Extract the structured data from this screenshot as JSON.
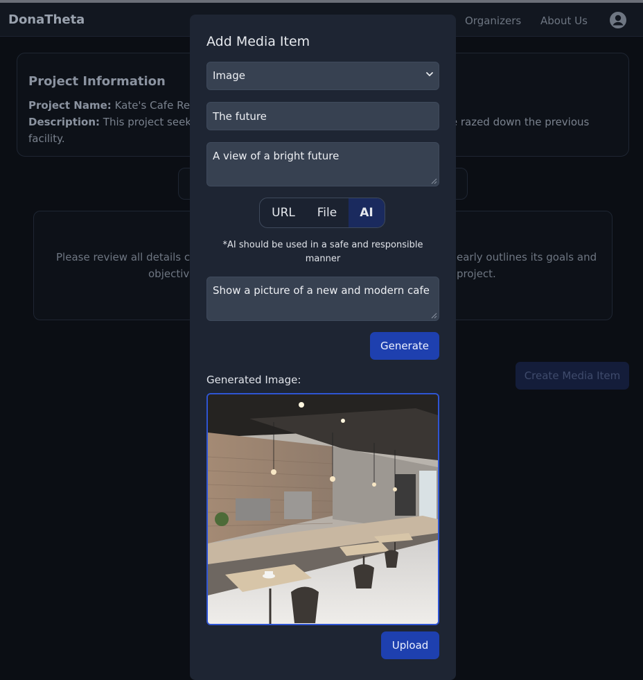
{
  "navbar": {
    "brand": "DonaTheta",
    "links": [
      "Organizers",
      "About Us"
    ],
    "account_icon": "account-circle-icon"
  },
  "project_info": {
    "title": "Project Information",
    "name_label": "Project Name:",
    "name_value": "Kate's Cafe Rebu",
    "description_label": "Description:",
    "description_value": "This project seeks",
    "description_right": "re razed down the previous",
    "description_cont": "facility."
  },
  "review_notice": {
    "left_line1": "Please review all details co",
    "left_line2": "objectiv",
    "right_line1": "early outlines its goals and",
    "right_line2": "project."
  },
  "create_button_label": "Create Media Item",
  "modal": {
    "title": "Add Media Item",
    "type_select": {
      "value": "Image",
      "options": [
        "Image"
      ]
    },
    "title_value": "The future",
    "description_value": "A view of a bright future",
    "source_tabs": [
      {
        "label": "URL",
        "active": false
      },
      {
        "label": "File",
        "active": false
      },
      {
        "label": "AI",
        "active": true
      }
    ],
    "ai_note": "*AI should be used in a safe and responsible manner",
    "prompt_value": "Show a picture of a new and modern cafe",
    "generate_label": "Generate",
    "generated_label": "Generated Image:",
    "upload_label": "Upload"
  },
  "colors": {
    "accent": "#1e40af",
    "modal_bg": "#1e2533",
    "field_bg": "#374151",
    "image_border": "#2f55d4"
  }
}
